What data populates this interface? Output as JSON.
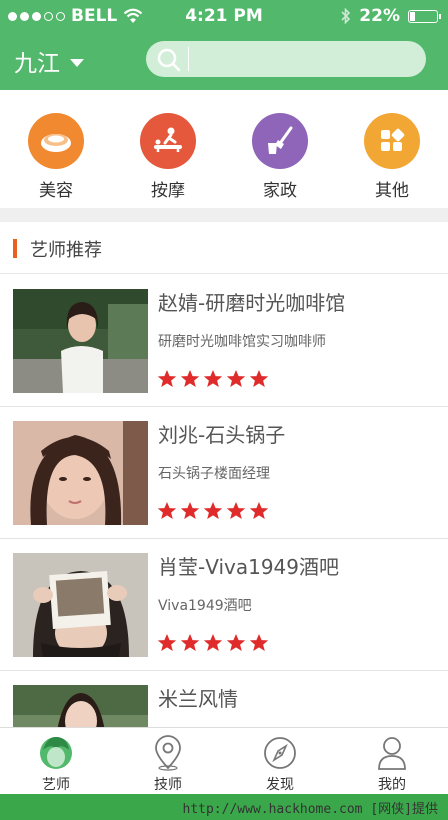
{
  "status_bar": {
    "carrier": "BELL",
    "time": "4:21 PM",
    "battery": "22%",
    "battery_level": 0.22,
    "signal_bars": 3
  },
  "nav": {
    "city": "九江",
    "search_placeholder": ""
  },
  "categories": [
    {
      "label": "美容",
      "icon": "beauty-icon",
      "color": "#f0892f"
    },
    {
      "label": "按摩",
      "icon": "massage-icon",
      "color": "#e5583c"
    },
    {
      "label": "家政",
      "icon": "housekeeping-icon",
      "color": "#8e65b8"
    },
    {
      "label": "其他",
      "icon": "other-icon",
      "color": "#f2a735"
    }
  ],
  "section": {
    "title": "艺师推荐"
  },
  "artists": [
    {
      "title": "赵婧-研磨时光咖啡馆",
      "subtitle": "研磨时光咖啡馆实习咖啡师",
      "rating": 5
    },
    {
      "title": "刘兆-石头锅子",
      "subtitle": "石头锅子楼面经理",
      "rating": 5
    },
    {
      "title": "肖莹-Viva1949酒吧",
      "subtitle": "Viva1949酒吧",
      "rating": 5
    },
    {
      "title": "米兰风情",
      "subtitle": "",
      "rating": 0
    }
  ],
  "tabs": [
    {
      "label": "艺师",
      "icon": "artist-icon",
      "active": true
    },
    {
      "label": "技师",
      "icon": "location-pin-icon",
      "active": false
    },
    {
      "label": "发现",
      "icon": "compass-icon",
      "active": false
    },
    {
      "label": "我的",
      "icon": "user-icon",
      "active": false
    }
  ],
  "watermark": "http://www.hackhome.com [网侠]提供",
  "colors": {
    "brand_green": "#52b86b",
    "accent_orange": "#e8621d",
    "star_red": "#e02b2b"
  }
}
